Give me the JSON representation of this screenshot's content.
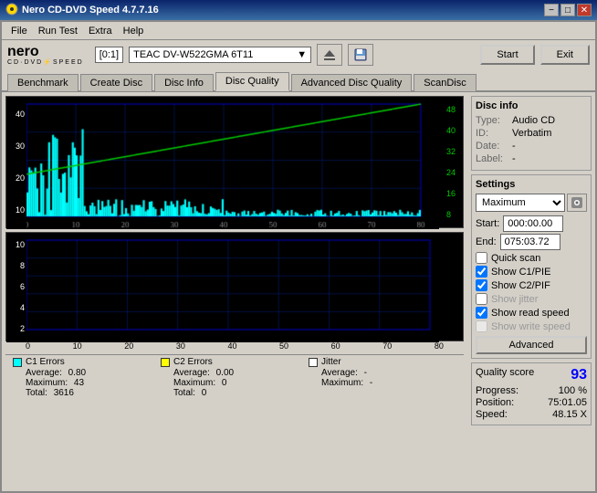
{
  "title_bar": {
    "title": "Nero CD-DVD Speed 4.7.7.16",
    "icon": "cd-icon",
    "min_label": "−",
    "max_label": "□",
    "close_label": "✕"
  },
  "menu": {
    "items": [
      "File",
      "Run Test",
      "Extra",
      "Help"
    ]
  },
  "toolbar": {
    "drive_label": "[0:1]",
    "drive_name": "TEAC DV-W522GMA 6T11",
    "start_label": "Start",
    "exit_label": "Exit"
  },
  "tabs": [
    {
      "id": "benchmark",
      "label": "Benchmark"
    },
    {
      "id": "create-disc",
      "label": "Create Disc"
    },
    {
      "id": "disc-info",
      "label": "Disc Info"
    },
    {
      "id": "disc-quality",
      "label": "Disc Quality"
    },
    {
      "id": "advanced-disc-quality",
      "label": "Advanced Disc Quality"
    },
    {
      "id": "scandisc",
      "label": "ScanDisc"
    }
  ],
  "active_tab": "disc-quality",
  "disc_info": {
    "section_title": "Disc info",
    "type_label": "Type:",
    "type_value": "Audio CD",
    "id_label": "ID:",
    "id_value": "Verbatim",
    "date_label": "Date:",
    "date_value": "-",
    "label_label": "Label:",
    "label_value": "-"
  },
  "settings": {
    "section_title": "Settings",
    "speed_value": "Maximum",
    "start_label": "Start:",
    "start_value": "000:00.00",
    "end_label": "End:",
    "end_value": "075:03.72",
    "quick_scan_label": "Quick scan",
    "show_c1_pie_label": "Show C1/PIE",
    "show_c2_pif_label": "Show C2/PIF",
    "show_jitter_label": "Show jitter",
    "show_read_speed_label": "Show read speed",
    "show_write_speed_label": "Show write speed",
    "advanced_button_label": "Advanced"
  },
  "quality": {
    "score_label": "Quality score",
    "score_value": "93",
    "progress_label": "Progress:",
    "progress_value": "100 %",
    "position_label": "Position:",
    "position_value": "75:01.05",
    "speed_label": "Speed:",
    "speed_value": "48.15 X"
  },
  "legend": {
    "c1_errors": {
      "label": "C1 Errors",
      "color": "#00ffff",
      "avg_label": "Average:",
      "avg_value": "0.80",
      "max_label": "Maximum:",
      "max_value": "43",
      "total_label": "Total:",
      "total_value": "3616"
    },
    "c2_errors": {
      "label": "C2 Errors",
      "color": "#ffff00",
      "avg_label": "Average:",
      "avg_value": "0.00",
      "max_label": "Maximum:",
      "max_value": "0",
      "total_label": "Total:",
      "total_value": "0"
    },
    "jitter": {
      "label": "Jitter",
      "color": "#ffffff",
      "avg_label": "Average:",
      "avg_value": "-",
      "max_label": "Maximum:",
      "max_value": "-",
      "total_label": "",
      "total_value": ""
    }
  },
  "chart_top": {
    "y_labels_left": [
      "40",
      "30",
      "20",
      "10"
    ],
    "y_labels_right": [
      "48",
      "40",
      "32",
      "24",
      "16",
      "8"
    ],
    "x_labels": [
      "0",
      "10",
      "20",
      "30",
      "40",
      "50",
      "60",
      "70",
      "80"
    ]
  },
  "chart_bottom": {
    "y_labels": [
      "10",
      "8",
      "6",
      "4",
      "2"
    ],
    "x_labels": [
      "0",
      "10",
      "20",
      "30",
      "40",
      "50",
      "60",
      "70",
      "80"
    ]
  }
}
